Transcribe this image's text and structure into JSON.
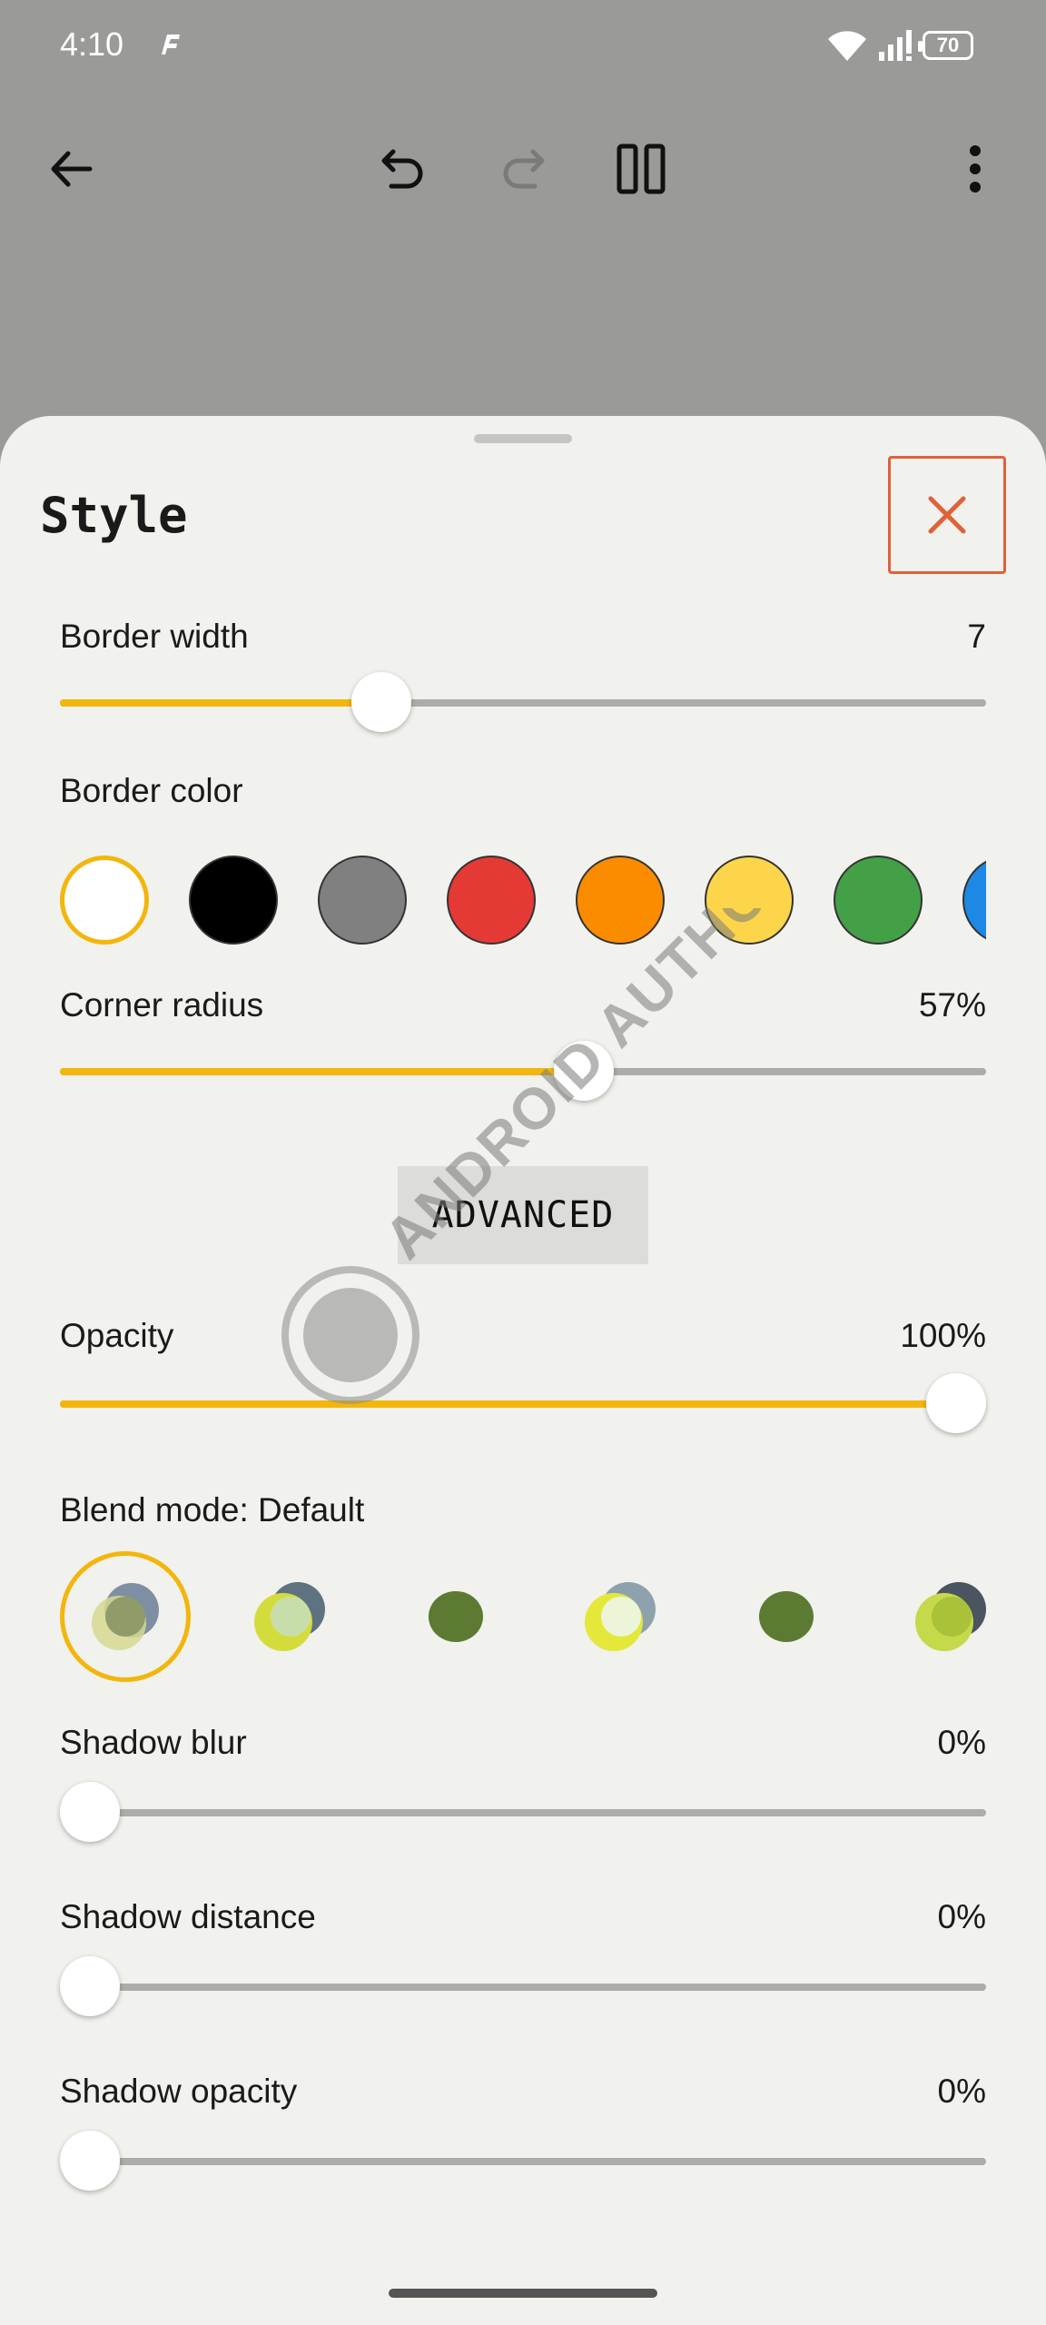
{
  "status_bar": {
    "time": "4:10",
    "battery": "70"
  },
  "toolbar": {
    "back_icon": "arrow-left-icon",
    "undo_icon": "undo-icon",
    "redo_icon": "redo-icon",
    "pause_icon": "pause-icon",
    "more_icon": "more-vertical-icon"
  },
  "sheet": {
    "title": "Style",
    "close_icon": "close-icon",
    "border_width": {
      "label": "Border width",
      "value": "7",
      "level": 0.336
    },
    "border_color": {
      "label": "Border color",
      "selected": "#ffffff",
      "swatches": [
        "#ffffff",
        "#000000",
        "#808080",
        "#e53935",
        "#fb8c00",
        "#fdd54b",
        "#43a047",
        "#1e88e5"
      ]
    },
    "corner_radius": {
      "label": "Corner radius",
      "value": "57%",
      "level": 0.57
    },
    "advanced_label": "ADVANCED",
    "opacity": {
      "label": "Opacity",
      "value": "100%",
      "level": 1.0
    },
    "blend_mode": {
      "label": "Blend mode: Default"
    },
    "shadow_blur": {
      "label": "Shadow blur",
      "value": "0%",
      "level": 0
    },
    "shadow_distance": {
      "label": "Shadow distance",
      "value": "0%",
      "level": 0
    },
    "shadow_opacity": {
      "label": "Shadow opacity",
      "value": "0%",
      "level": 0
    }
  },
  "watermark": {
    "text": "ANDROID AUTHORITY"
  },
  "colors": {
    "accent": "#f2b60c",
    "close": "#e0613a",
    "sheet_bg": "#f1f1ed",
    "scrim": "#9a9b98"
  }
}
